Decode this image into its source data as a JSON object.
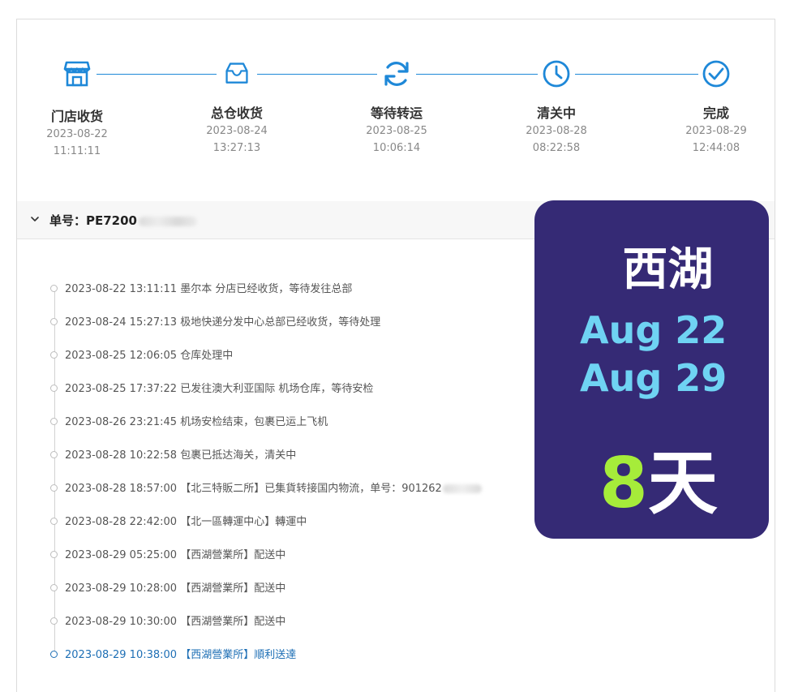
{
  "steps": [
    {
      "label": "门店收货",
      "date": "2023-08-22",
      "time": "11:11:11",
      "icon": "store-icon"
    },
    {
      "label": "总仓收货",
      "date": "2023-08-24",
      "time": "13:27:13",
      "icon": "inbox-icon"
    },
    {
      "label": "等待转运",
      "date": "2023-08-25",
      "time": "10:06:14",
      "icon": "refresh-icon"
    },
    {
      "label": "清关中",
      "date": "2023-08-28",
      "time": "08:22:58",
      "icon": "clock-icon"
    },
    {
      "label": "完成",
      "date": "2023-08-29",
      "time": "12:44:08",
      "icon": "check-circle-icon"
    }
  ],
  "order": {
    "label": "单号：PE7200",
    "chevron_icon": "chevron-down-icon"
  },
  "events": [
    "2023-08-22 13:11:11 墨尔本 分店已经收货，等待发往总部",
    "2023-08-24 15:27:13 极地快递分发中心总部已经收货，等待处理",
    "2023-08-25 12:06:05 仓库处理中",
    "2023-08-25 17:37:22 已发往澳大利亚国际 机场仓库，等待安检",
    "2023-08-26 23:21:45 机场安检结束，包裹已运上飞机",
    "2023-08-28 10:22:58 包裹已抵达海关，清关中",
    "2023-08-28 18:57:00 【北三特販二所】已集貨转接国内物流，单号：901262",
    "2023-08-28 22:42:00 【北一區轉運中心】轉運中",
    "2023-08-29 05:25:00 【西湖營業所】配送中",
    "2023-08-29 10:28:00 【西湖營業所】配送中",
    "2023-08-29 10:30:00 【西湖營業所】配送中",
    "2023-08-29 10:38:00 【西湖營業所】順利送達"
  ],
  "overlay": {
    "city": "西湖",
    "date_start": "Aug 22",
    "date_end": "Aug 29",
    "days_number": "8",
    "days_unit": "天"
  },
  "colors": {
    "accent": "#1e88d8",
    "overlay_bg": "#352a75",
    "overlay_date": "#6fd3f3",
    "overlay_number": "#a6ec3a"
  }
}
